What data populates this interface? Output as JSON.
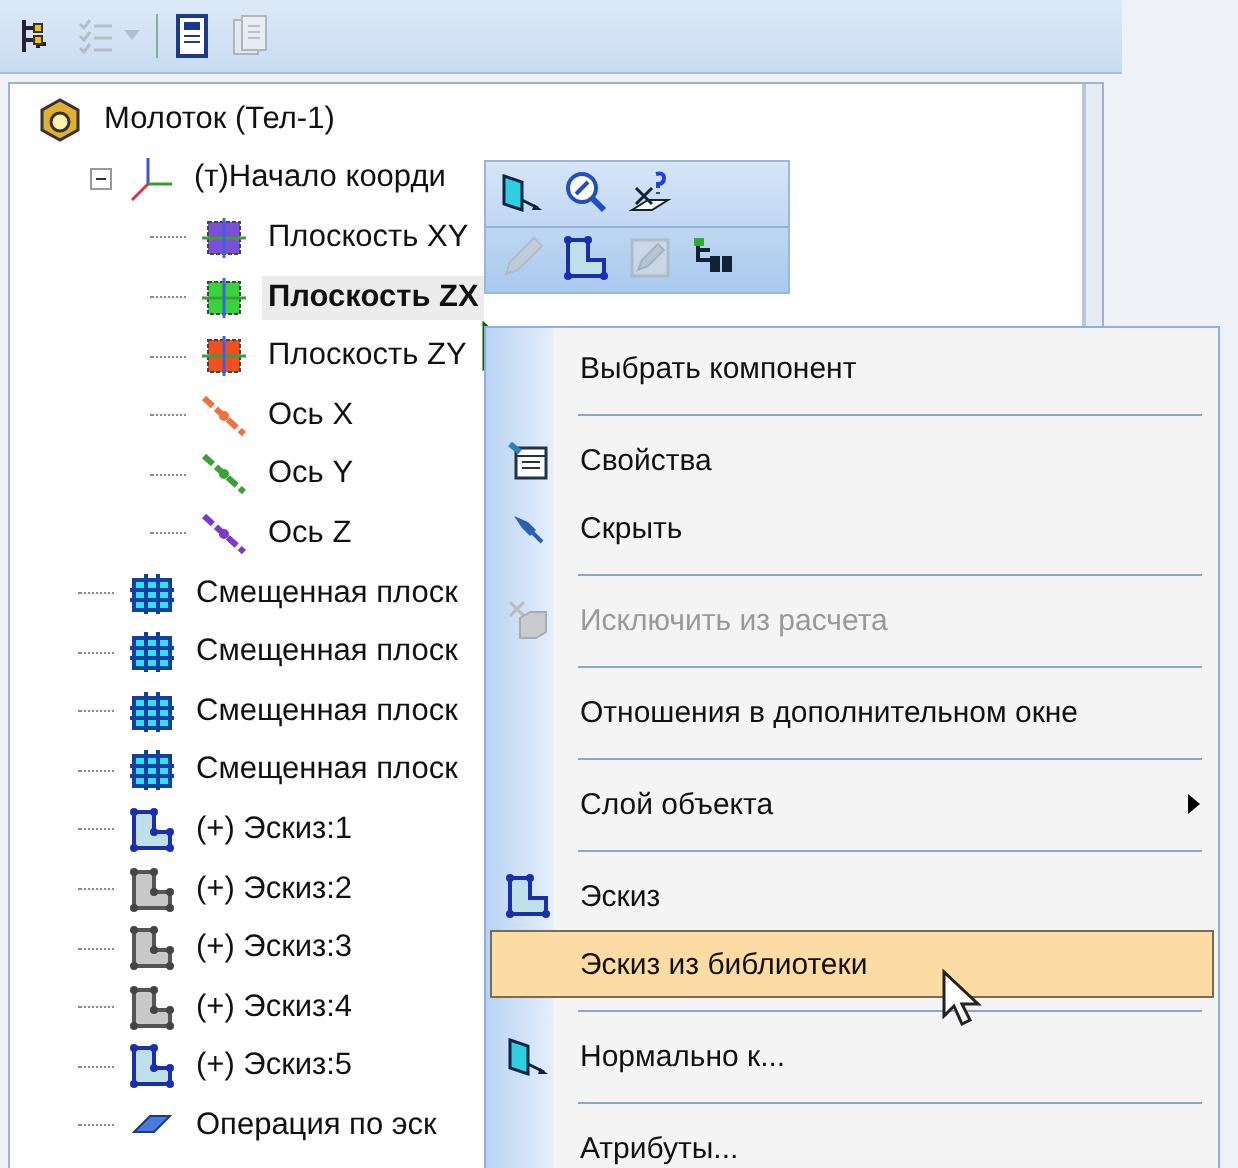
{
  "toolbar": [
    {
      "kind": "tree",
      "disabled": false
    },
    {
      "kind": "checklist",
      "disabled": true,
      "dropdown": true
    },
    {
      "kind": "separator"
    },
    {
      "kind": "document",
      "disabled": false
    },
    {
      "kind": "document-copy",
      "disabled": true
    }
  ],
  "tree": [
    {
      "label": "Молоток (Тел-1)",
      "kind": "part",
      "selected": false,
      "children": [
        {
          "label": "(т)Начало коорди",
          "kind": "origin",
          "selected": false,
          "expanded": true,
          "children": [
            {
              "label": "Плоскость XY",
              "kind": "plane",
              "color": "#7b4fd6",
              "selected": false
            },
            {
              "label": "Плоскость ZX",
              "kind": "plane",
              "color": "#38d33a",
              "selected": true
            },
            {
              "label": "Плоскость ZY",
              "kind": "plane",
              "color": "#f0501e",
              "selected": false
            },
            {
              "label": "Ось X",
              "kind": "axis",
              "color": "#f07040",
              "selected": false
            },
            {
              "label": "Ось Y",
              "kind": "axis",
              "color": "#3aa03a",
              "selected": false
            },
            {
              "label": "Ось Z",
              "kind": "axis",
              "color": "#7a3ad0",
              "selected": false
            }
          ]
        },
        {
          "label": "Смещенная плоск",
          "kind": "offset-plane",
          "selected": false
        },
        {
          "label": "Смещенная плоск",
          "kind": "offset-plane",
          "selected": false
        },
        {
          "label": "Смещенная плоск",
          "kind": "offset-plane",
          "selected": false
        },
        {
          "label": "Смещенная плоск",
          "kind": "offset-plane",
          "selected": false
        },
        {
          "label": "(+) Эскиз:1",
          "kind": "sketch",
          "dimmed": false,
          "selected": false
        },
        {
          "label": "(+) Эскиз:2",
          "kind": "sketch",
          "dimmed": true,
          "selected": false
        },
        {
          "label": "(+) Эскиз:3",
          "kind": "sketch",
          "dimmed": true,
          "selected": false
        },
        {
          "label": "(+) Эскиз:4",
          "kind": "sketch",
          "dimmed": true,
          "selected": false
        },
        {
          "label": "(+) Эскиз:5",
          "kind": "sketch",
          "dimmed": false,
          "selected": false
        },
        {
          "label": "Операция по эск",
          "kind": "operation",
          "selected": false
        }
      ]
    }
  ],
  "mini_toolbar": [
    [
      {
        "kind": "normal-view",
        "disabled": false
      },
      {
        "kind": "zoom",
        "disabled": false
      },
      {
        "kind": "query",
        "disabled": false
      }
    ],
    [
      {
        "kind": "pencil",
        "disabled": true
      },
      {
        "kind": "sketch",
        "disabled": false
      },
      {
        "kind": "edit-sketch",
        "disabled": true
      },
      {
        "kind": "hierarchy",
        "disabled": false
      }
    ]
  ],
  "context_menu": [
    {
      "kind": "item",
      "label": "Выбрать компонент",
      "disabled": false,
      "selected": false
    },
    {
      "kind": "separator"
    },
    {
      "kind": "item",
      "label": "Свойства",
      "disabled": false,
      "selected": false
    },
    {
      "kind": "item",
      "label": "Скрыть",
      "disabled": false,
      "selected": false
    },
    {
      "kind": "separator"
    },
    {
      "kind": "item",
      "label": "Исключить из расчета",
      "disabled": true,
      "selected": false
    },
    {
      "kind": "separator"
    },
    {
      "kind": "item",
      "label": "Отношения в дополнительном окне",
      "disabled": false,
      "selected": false
    },
    {
      "kind": "separator"
    },
    {
      "kind": "item",
      "label": "Слой объекта",
      "disabled": false,
      "selected": false,
      "submenu": true
    },
    {
      "kind": "separator"
    },
    {
      "kind": "item",
      "label": "Эскиз",
      "disabled": false,
      "selected": false
    },
    {
      "kind": "item",
      "label": "Эскиз из библиотеки",
      "disabled": false,
      "selected": true
    },
    {
      "kind": "separator"
    },
    {
      "kind": "item",
      "label": "Нормально к...",
      "disabled": false,
      "selected": false
    },
    {
      "kind": "separator"
    },
    {
      "kind": "item",
      "label": "Атрибуты...",
      "disabled": false,
      "selected": false
    }
  ]
}
